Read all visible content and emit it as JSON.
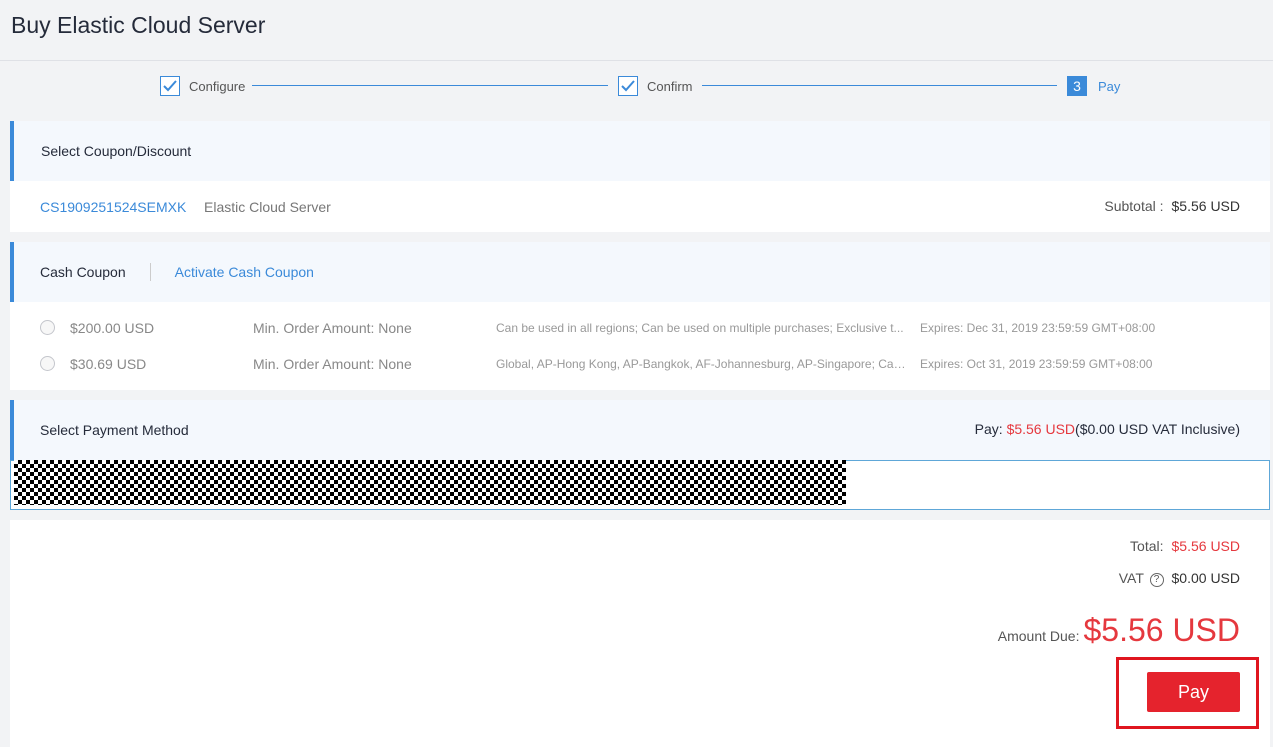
{
  "page": {
    "title": "Buy Elastic Cloud Server"
  },
  "steps": [
    {
      "label": "Configure",
      "state": "done"
    },
    {
      "label": "Confirm",
      "state": "done"
    },
    {
      "number": "3",
      "label": "Pay",
      "state": "active"
    }
  ],
  "coupon_section": {
    "title": "Select Coupon/Discount",
    "order_id": "CS1909251524SEMXK",
    "product": "Elastic Cloud Server",
    "subtotal_label": "Subtotal :",
    "subtotal_value": "$5.56 USD"
  },
  "cash_coupon": {
    "tab_label": "Cash Coupon",
    "activate_label": "Activate Cash Coupon",
    "items": [
      {
        "amount": "$200.00 USD",
        "min_order": "Min. Order Amount: None",
        "description": "Can be used in all regions; Can be used on multiple purchases; Exclusive t...",
        "expires": "Expires: Dec 31, 2019 23:59:59 GMT+08:00"
      },
      {
        "amount": "$30.69 USD",
        "min_order": "Min. Order Amount: None",
        "description": "Global, AP-Hong Kong, AP-Bangkok, AF-Johannesburg, AP-Singapore; Can ...",
        "expires": "Expires: Oct 31, 2019 23:59:59 GMT+08:00"
      }
    ]
  },
  "payment_method": {
    "title": "Select Payment Method",
    "pay_label": "Pay:",
    "pay_amount": "$5.56 USD",
    "vat_note": "($0.00 USD VAT Inclusive)"
  },
  "summary": {
    "total_label": "Total:",
    "total_value": "$5.56 USD",
    "vat_label": "VAT",
    "vat_value": "$0.00 USD",
    "amount_due_label": "Amount Due:",
    "amount_due_value": "$5.56 USD",
    "pay_button": "Pay"
  },
  "colors": {
    "accent": "#3b8ad9",
    "price_red": "#e5383e",
    "pay_button": "#e5232d",
    "highlight_frame": "#e0151f"
  }
}
